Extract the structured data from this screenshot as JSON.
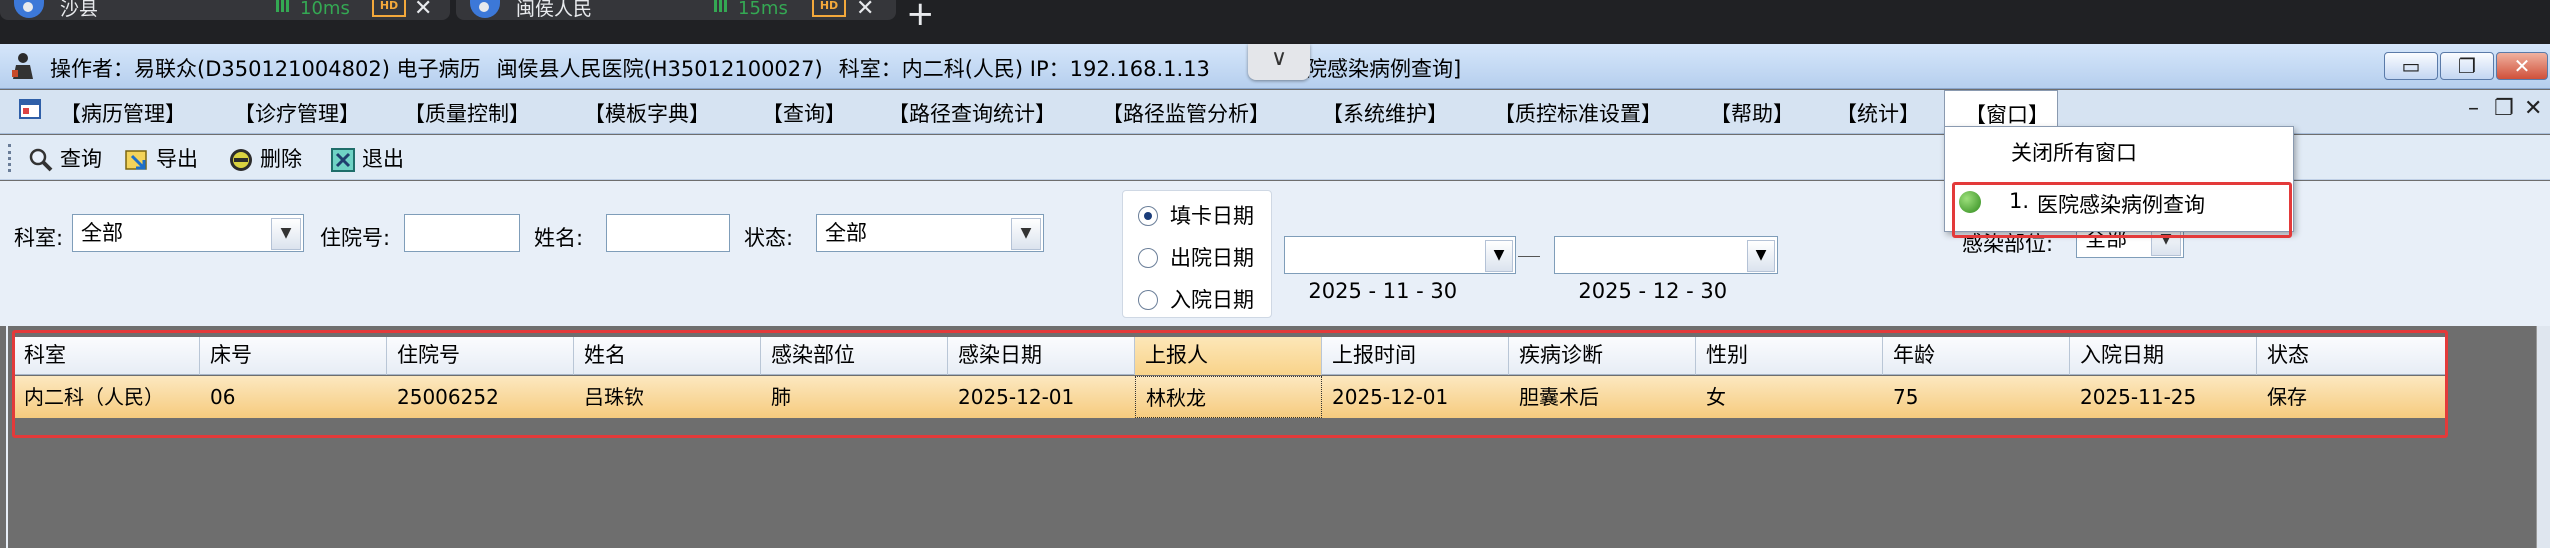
{
  "browser_tabs": [
    {
      "title": "沙县",
      "ping": "10ms",
      "badge": "HD"
    },
    {
      "title": "闽侯人民",
      "ping": "15ms",
      "badge": "HD"
    }
  ],
  "title_bar": {
    "operator": "操作者：易联众(D350121004802) 电子病历",
    "hospital": "闽侯县人民医院(H35012100027)",
    "dept_ip": "科室：内二科(人民)  IP：192.168.1.13",
    "window_suffix": "院感染病例查询]",
    "dropdown_glyph": "∨",
    "min_glyph": "▭",
    "restore_glyph": "❐",
    "close_glyph": "✕"
  },
  "menu": {
    "items": [
      "【病历管理】",
      "【诊疗管理】",
      "【质量控制】",
      "【模板字典】",
      "【查询】",
      "【路径查询统计】",
      "【路径监管分析】",
      "【系统维护】",
      "【质控标准设置】",
      "【帮助】",
      "【统计】"
    ],
    "active": "【窗口】",
    "mdi_min": "–",
    "mdi_restore": "❐",
    "mdi_close": "✕"
  },
  "window_dropdown": {
    "close_all": "关闭所有窗口",
    "item_number": "1.",
    "item_label": "医院感染病例查询"
  },
  "toolbar": {
    "query": "查询",
    "export": "导出",
    "delete": "删除",
    "exit": "退出"
  },
  "filter": {
    "dept_label": "科室:",
    "dept_value": "全部",
    "admission_no_label": "住院号:",
    "name_label": "姓名:",
    "status_label": "状态:",
    "status_value": "全部",
    "date_types": [
      "填卡日期",
      "出院日期",
      "入院日期"
    ],
    "date_from": "2025 - 11 - 30",
    "date_to": "2025 - 12 - 30",
    "infection_site_label": "感染部位:",
    "infection_site_value": "全部"
  },
  "grid": {
    "columns": [
      "科室",
      "床号",
      "住院号",
      "姓名",
      "感染部位",
      "感染日期",
      "上报人",
      "上报时间",
      "疾病诊断",
      "性别",
      "年龄",
      "入院日期",
      "状态"
    ],
    "rows": [
      [
        "内二科（人民）",
        "06",
        "25006252",
        "吕珠钦",
        "肺",
        "2025-12-01",
        "林秋龙",
        "2025-12-01",
        "胆囊术后",
        "女",
        "75",
        "2025-11-25",
        "保存"
      ]
    ]
  }
}
